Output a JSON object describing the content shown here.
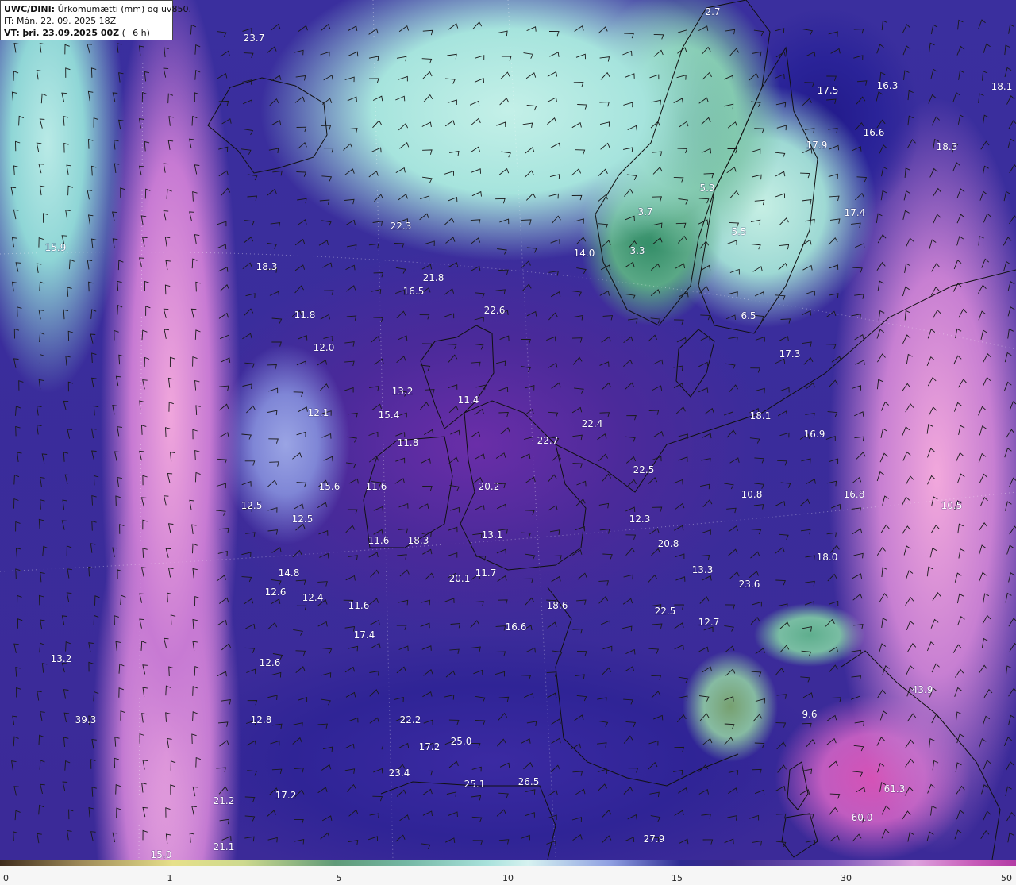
{
  "header": {
    "product": "UWC/DINI:",
    "description": "Úrkomumætti (mm) og uv850.",
    "it_label": "IT:",
    "it_value": "Mán. 22. 09. 2025 18Z",
    "vt_label": "VT:",
    "vt_value": "þri. 23.09.2025 00Z",
    "lead": "(+6 h)"
  },
  "colorbar": {
    "ticks": [
      "0",
      "1",
      "5",
      "10",
      "15",
      "30",
      "50"
    ]
  },
  "value_labels": [
    "23.7",
    "2.7",
    "17.5",
    "16.3",
    "18.1",
    "16.6",
    "17.9",
    "18.3",
    "22.3",
    "15.9",
    "18.3",
    "21.8",
    "16.5",
    "22.6",
    "11.8",
    "12.0",
    "13.2",
    "11.4",
    "15.4",
    "12.1",
    "11.8",
    "22.7",
    "22.4",
    "17.4",
    "17.3",
    "18.1",
    "16.9",
    "20.2",
    "22.5",
    "15.6",
    "11.6",
    "12.5",
    "12.5",
    "11.6",
    "18.3",
    "13.1",
    "12.3",
    "20.8",
    "10.8",
    "16.8",
    "10.5",
    "14.8",
    "12.6",
    "12.4",
    "11.6",
    "20.1",
    "11.7",
    "13.3",
    "18.0",
    "23.6",
    "18.6",
    "22.5",
    "12.7",
    "17.4",
    "16.6",
    "13.2",
    "12.6",
    "22.2",
    "25.0",
    "17.2",
    "12.8",
    "21.2",
    "17.2",
    "23.4",
    "25.1",
    "26.5",
    "21.1",
    "15.0",
    "27.9",
    "61.3",
    "60.0",
    "43.9",
    "9.6",
    "14.0",
    "3.3",
    "5.5",
    "6.5",
    "3.7",
    "5.3",
    "39.3"
  ]
}
